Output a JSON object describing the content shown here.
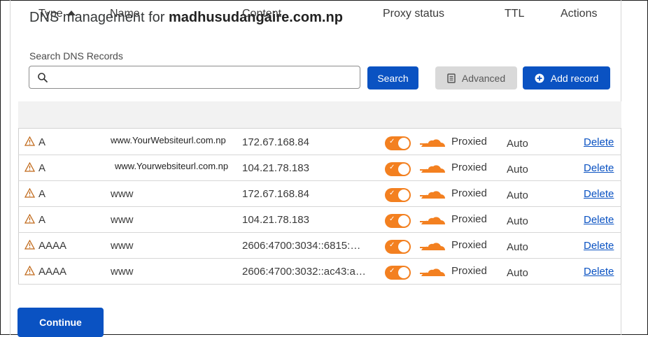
{
  "header": {
    "title_prefix": "DNS management for",
    "domain": "madhusudangaire.com.np"
  },
  "search": {
    "label": "Search DNS Records",
    "value": "",
    "placeholder": "",
    "button_label": "Search"
  },
  "toolbar": {
    "advanced_label": "Advanced",
    "add_record_label": "Add record"
  },
  "table": {
    "columns": {
      "type": "Type",
      "name": "Name",
      "content": "Content",
      "proxy_status": "Proxy status",
      "ttl": "TTL",
      "actions": "Actions"
    },
    "rows": [
      {
        "type": "A",
        "name": "www.YourWebsiteurl.com.np",
        "content": "172.67.168.84",
        "proxy": "Proxied",
        "ttl": "Auto",
        "action": "Delete"
      },
      {
        "type": "A",
        "name": "www.Yourwebsiteurl.com.np",
        "content": "104.21.78.183",
        "proxy": "Proxied",
        "ttl": "Auto",
        "action": "Delete"
      },
      {
        "type": "A",
        "name": "www",
        "content": "172.67.168.84",
        "proxy": "Proxied",
        "ttl": "Auto",
        "action": "Delete"
      },
      {
        "type": "A",
        "name": "www",
        "content": "104.21.78.183",
        "proxy": "Proxied",
        "ttl": "Auto",
        "action": "Delete"
      },
      {
        "type": "AAAA",
        "name": "www",
        "content": "2606:4700:3034::6815:…",
        "proxy": "Proxied",
        "ttl": "Auto",
        "action": "Delete"
      },
      {
        "type": "AAAA",
        "name": "www",
        "content": "2606:4700:3032::ac43:a…",
        "proxy": "Proxied",
        "ttl": "Auto",
        "action": "Delete"
      }
    ]
  },
  "footer": {
    "continue_label": "Continue"
  },
  "colors": {
    "primary": "#0a52c2",
    "proxy_orange": "#f38020",
    "warning": "#c0691a"
  }
}
